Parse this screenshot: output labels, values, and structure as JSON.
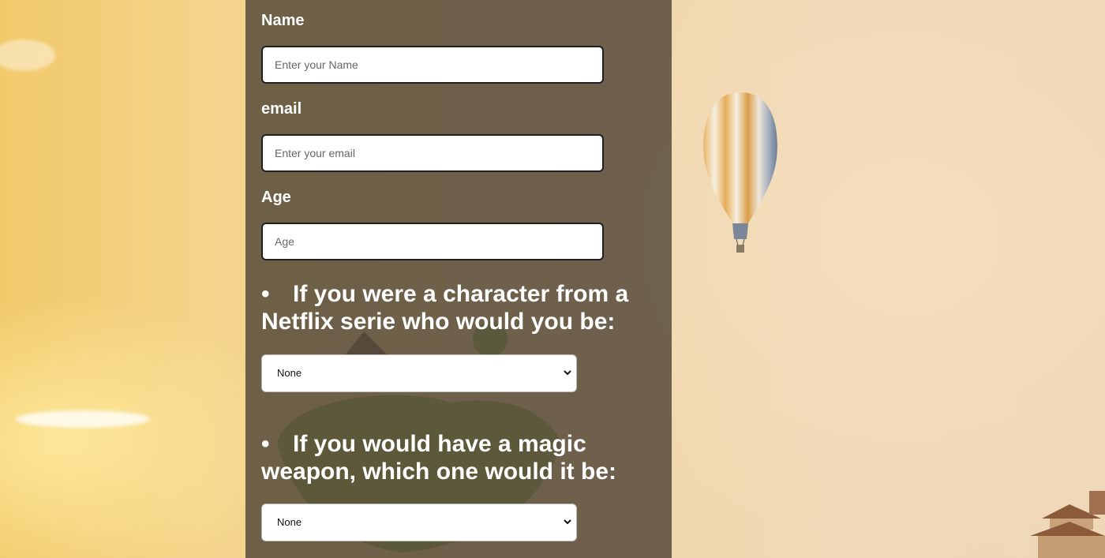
{
  "form": {
    "name": {
      "label": "Name",
      "placeholder": "Enter your Name",
      "value": ""
    },
    "email": {
      "label": "email",
      "placeholder": "Enter your email",
      "value": ""
    },
    "age": {
      "label": "Age",
      "placeholder": "Age",
      "value": ""
    },
    "questions": [
      {
        "bullet": "•",
        "text": "If you were a character from a Netflix serie who would you be:",
        "selected": "None"
      },
      {
        "bullet": "•",
        "text": "If you would have a magic weapon, which one would it be:",
        "selected": "None"
      }
    ]
  },
  "colors": {
    "panel": "#504637",
    "label_text": "#ffffff",
    "input_background": "#ffffff"
  },
  "icons": {
    "select_arrow": "chevron-down-icon"
  }
}
